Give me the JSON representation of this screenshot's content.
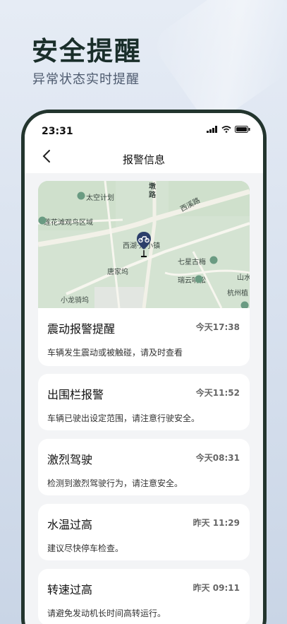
{
  "hero": {
    "title": "安全提醒",
    "subtitle": "异常状态实时提醒"
  },
  "statusbar": {
    "time": "23:31"
  },
  "navbar": {
    "title": "报警信息"
  },
  "map": {
    "labels": {
      "dun_road": "墩\n路",
      "space_plan": "太空计划",
      "lotus": "莲花滩观鸟区域",
      "xixi_road": "西溪路",
      "xihu_town": "西湖·双小镇",
      "qixing": "七星古梅",
      "tangjiawu": "唐家坞",
      "ruiyun": "瑞云听松",
      "shanshui": "山水",
      "hangzhou": "杭州植",
      "xiaolong": "小龙骑坞"
    }
  },
  "alerts": [
    {
      "title": "震动报警提醒",
      "time": "今天17:38",
      "desc": "车辆发生震动或被触碰，请及时查看"
    },
    {
      "title": "出围栏报警",
      "time": "今天11:52",
      "desc": "车辆已驶出设定范围，请注意行驶安全。"
    },
    {
      "title": "激烈驾驶",
      "time": "今天08:31",
      "desc": "检测到激烈驾驶行为，请注意安全。"
    },
    {
      "title": "水温过高",
      "time": "昨天 11:29",
      "desc": "建议尽快停车检查。"
    },
    {
      "title": "转速过高",
      "time": "昨天 09:11",
      "desc": "请避免发动机长时间高转运行。"
    }
  ]
}
